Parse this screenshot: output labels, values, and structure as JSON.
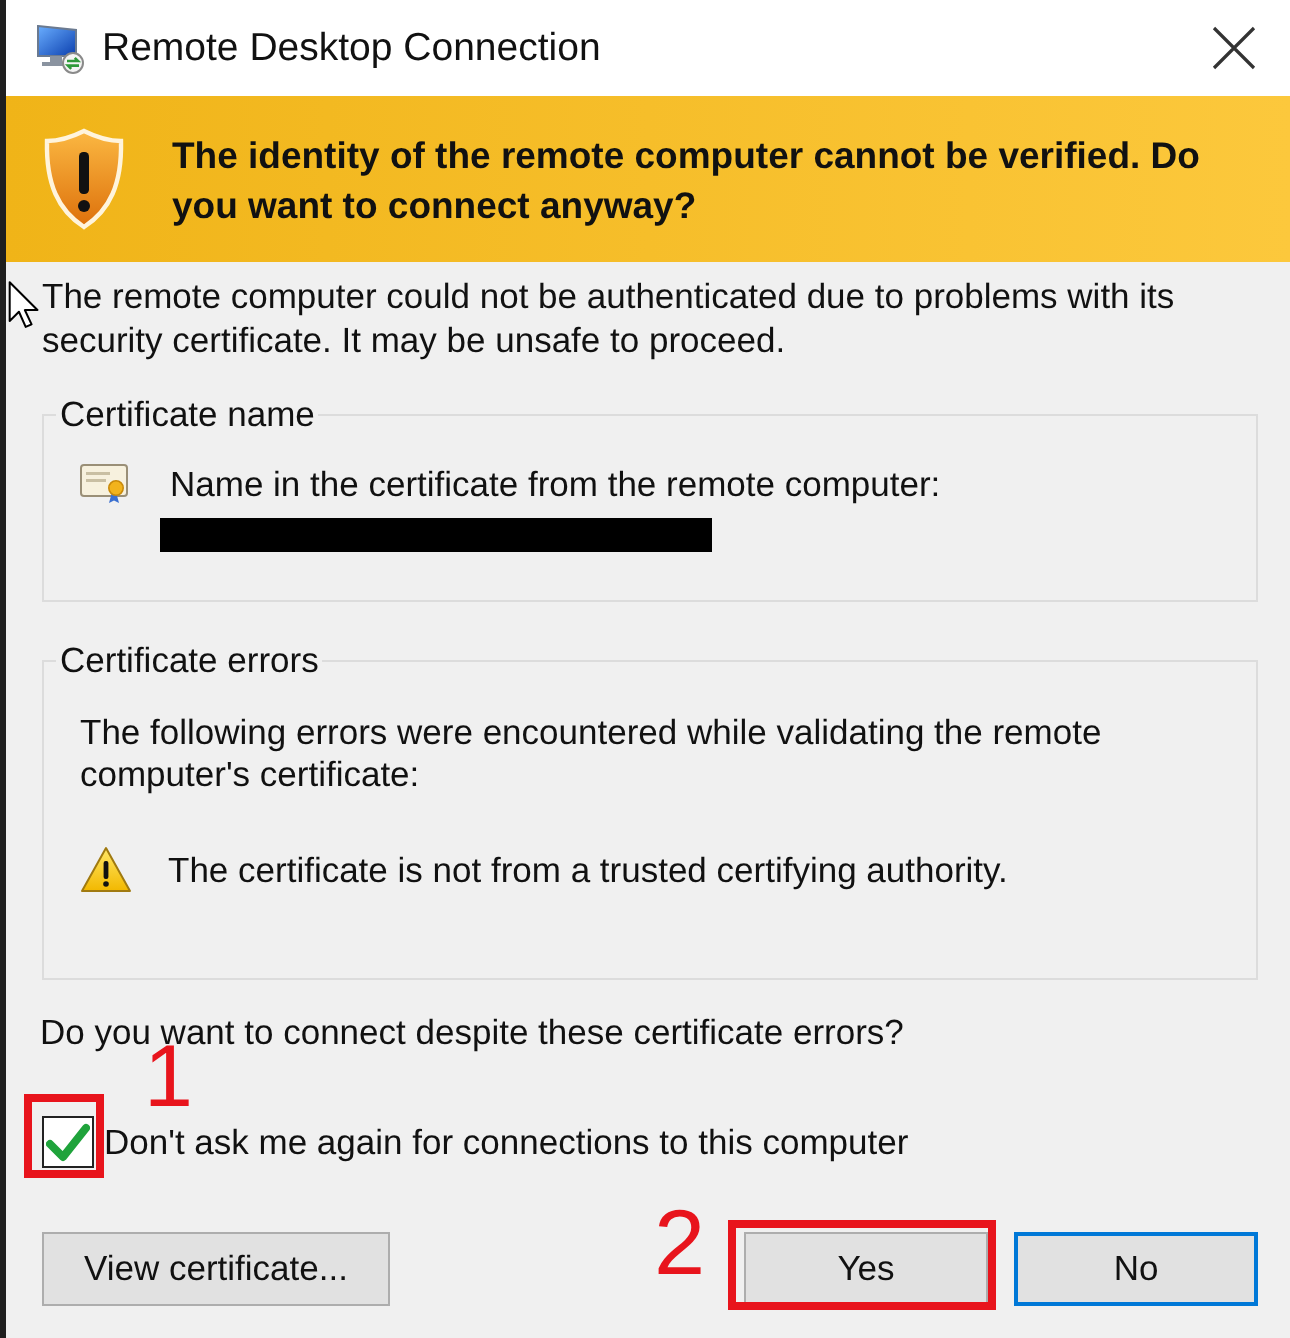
{
  "window": {
    "title": "Remote Desktop Connection"
  },
  "banner": {
    "message": "The identity of the remote computer cannot be verified. Do you want to connect anyway?"
  },
  "intro": "The remote computer could not be authenticated due to problems with its security certificate. It may be unsafe to proceed.",
  "certificate_name": {
    "title": "Certificate name",
    "label": "Name in the certificate from the remote computer:",
    "value_redacted": true
  },
  "certificate_errors": {
    "title": "Certificate errors",
    "description": "The following errors were encountered while validating the remote computer's certificate:",
    "errors": [
      "The certificate is not from a trusted certifying authority."
    ]
  },
  "question": "Do you want to connect despite these certificate errors?",
  "dont_ask_again": {
    "label": "Don't ask me again for connections to this computer",
    "checked": true
  },
  "buttons": [
    {
      "label": "View certificate...",
      "default": false
    },
    {
      "label": "Yes",
      "default": false
    },
    {
      "label": "No",
      "default": true
    }
  ],
  "annotations": [
    {
      "label": "1"
    },
    {
      "label": "2"
    }
  ]
}
